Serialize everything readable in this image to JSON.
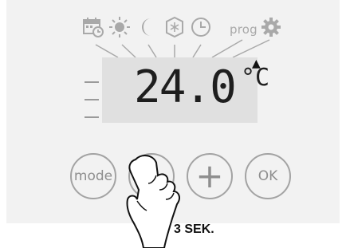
{
  "panel": {
    "icons": [
      {
        "name": "calendar-clock-icon"
      },
      {
        "name": "sun-icon"
      },
      {
        "name": "moon-icon"
      },
      {
        "name": "snowflake-icon"
      },
      {
        "name": "clock-icon"
      },
      {
        "name": "prog-label",
        "text": "prog"
      },
      {
        "name": "gear-icon"
      }
    ],
    "display": {
      "temperature": "24.0",
      "unit": "°C",
      "indicator": "▲"
    },
    "buttons": {
      "mode": "mode",
      "minus": "−",
      "plus": "+",
      "ok": "OK"
    }
  },
  "caption": "3 SEK.",
  "colors": {
    "panel_bg": "#f2f2f2",
    "lcd_bg": "#e0e0e0",
    "icon_gray": "#a9a9a9",
    "segment": "#1e1e1e"
  }
}
